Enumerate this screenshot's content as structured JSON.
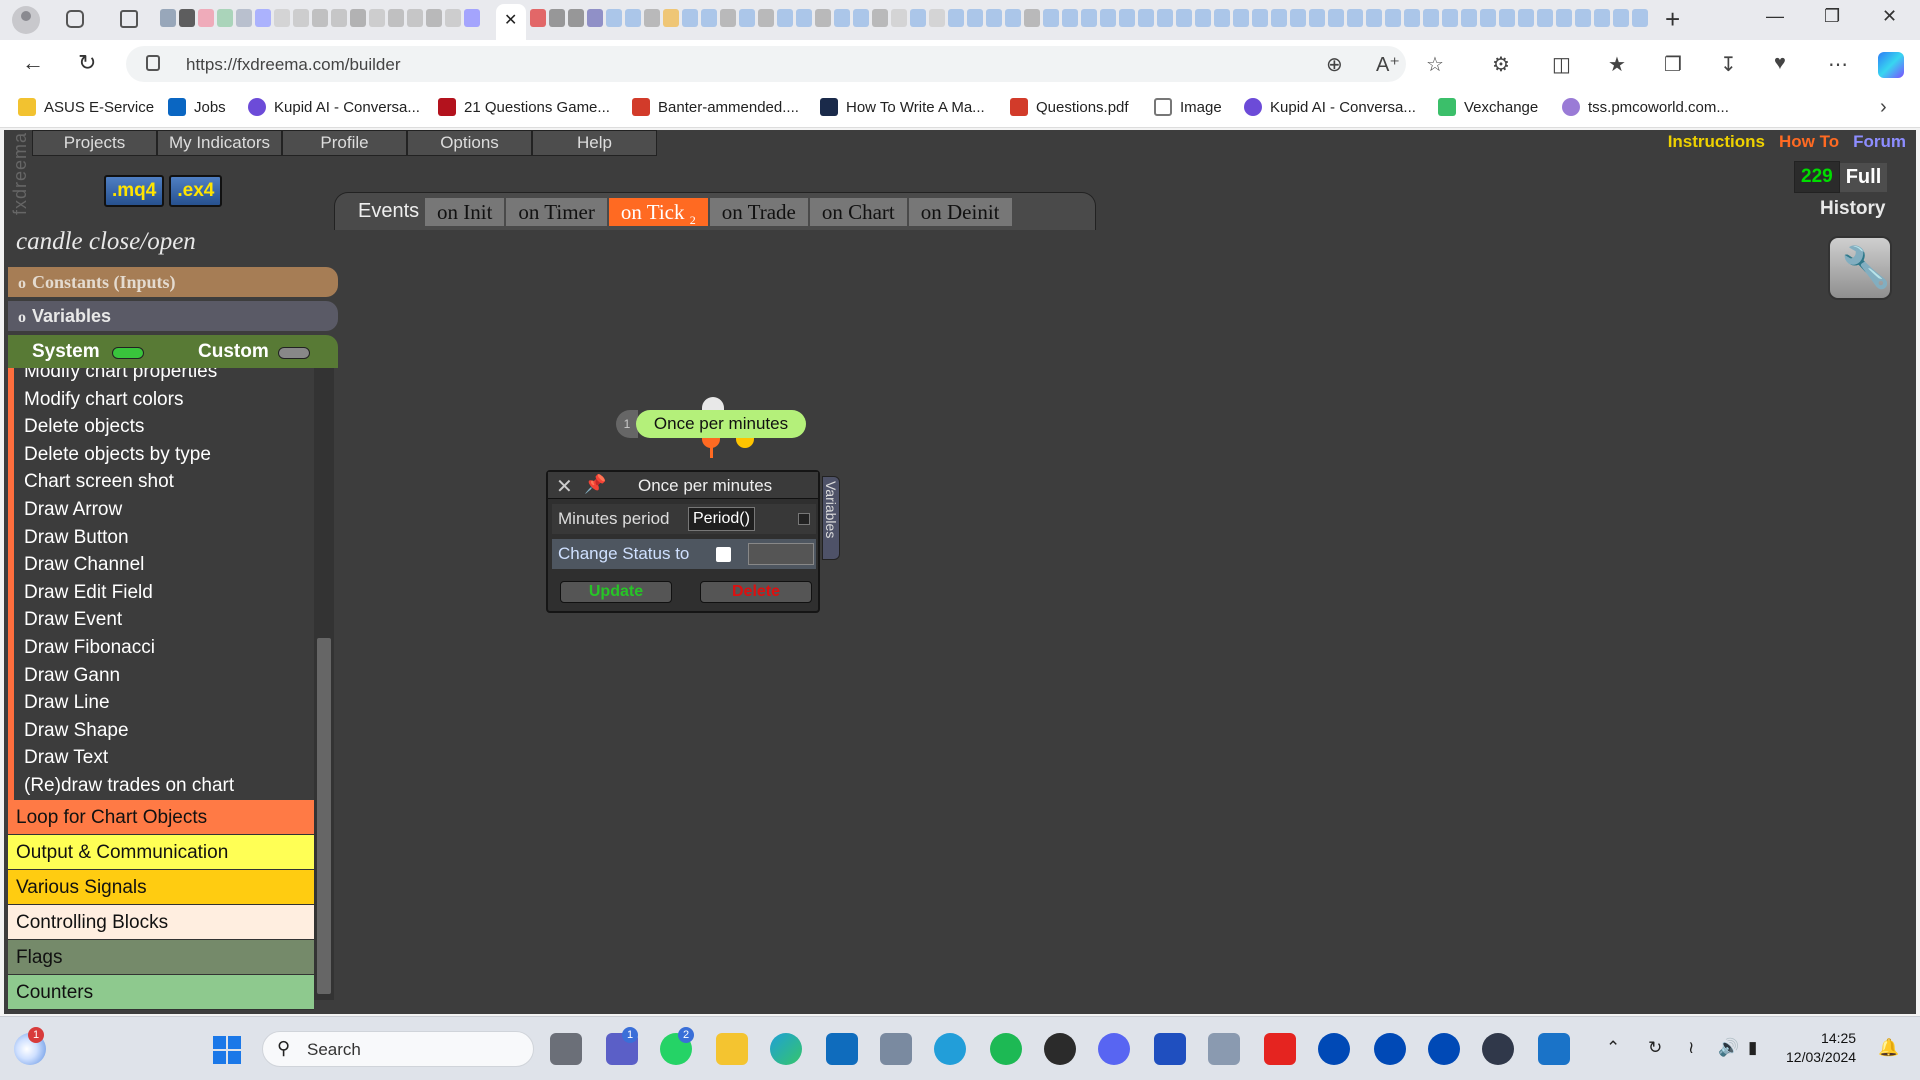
{
  "browser": {
    "url": "https://fxdreema.com/builder",
    "close_tab_glyph": "✕",
    "new_tab_glyph": "+",
    "bookmarks": [
      {
        "label": "ASUS E-Service",
        "icon": "folder-icon",
        "color": "#f2c230"
      },
      {
        "label": "Jobs",
        "icon": "linkedin-icon",
        "color": "#0a66c2"
      },
      {
        "label": "Kupid AI - Conversa...",
        "icon": "kupid-icon",
        "color": "#6c4bd8"
      },
      {
        "label": "21 Questions Game...",
        "icon": "tv-icon",
        "color": "#b3121d"
      },
      {
        "label": "Banter-ammended....",
        "icon": "pdf-icon",
        "color": "#d23b2a"
      },
      {
        "label": "How To Write A Ma...",
        "icon": "v-icon",
        "color": "#1a2a4a"
      },
      {
        "label": "Questions.pdf",
        "icon": "pdf-icon",
        "color": "#d23b2a"
      },
      {
        "label": "Image",
        "icon": "file-icon",
        "color": "#777777"
      },
      {
        "label": "Kupid AI - Conversa...",
        "icon": "kupid-icon",
        "color": "#6c4bd8"
      },
      {
        "label": "Vexchange",
        "icon": "vexchange-icon",
        "color": "#3bbf6a"
      },
      {
        "label": "tss.pmcoworld.com...",
        "icon": "globe-icon",
        "color": "#9a7bd6"
      }
    ]
  },
  "app": {
    "logo": "fxdreema",
    "menu": [
      "Projects",
      "My Indicators",
      "Profile",
      "Options",
      "Help"
    ],
    "ext_buttons": [
      ".mq4",
      ".ex4"
    ],
    "project_name": "candle close/open",
    "constants_label": "Constants (Inputs)",
    "variables_label": "Variables",
    "panel_bullet": "o",
    "system_label": "System",
    "custom_label": "Custom",
    "block_items": [
      "Modify chart properties",
      "Modify chart colors",
      "Delete objects",
      "Delete objects by type",
      "Chart screen shot",
      "Draw Arrow",
      "Draw Button",
      "Draw Channel",
      "Draw Edit Field",
      "Draw Event",
      "Draw Fibonacci",
      "Draw Gann",
      "Draw Line",
      "Draw Shape",
      "Draw Text",
      "(Re)draw trades on chart"
    ],
    "categories": {
      "loop": "Loop for Chart Objects",
      "output": "Output & Communication",
      "signals": "Various Signals",
      "control": "Controlling Blocks",
      "flags": "Flags",
      "counters": "Counters"
    },
    "events_label": "Events",
    "event_tabs": [
      "on Init",
      "on Timer",
      "on Tick",
      "on Trade",
      "on Chart",
      "on Deinit"
    ],
    "on_tick_sub": "2",
    "active_event": "on Tick",
    "links": {
      "instructions": "Instructions",
      "howto": "How To",
      "forum": "Forum"
    },
    "count": "229",
    "full": "Full",
    "history": "History",
    "block": {
      "number": "1",
      "label": "Once per minutes"
    },
    "dialog": {
      "title": "Once per minutes",
      "minutes_label": "Minutes period",
      "minutes_value": "Period()",
      "status_label": "Change Status to",
      "update": "Update",
      "delete": "Delete",
      "side_tab": "Variables"
    }
  },
  "taskbar": {
    "search_placeholder": "Search",
    "time": "14:25",
    "date": "12/03/2024",
    "badges": {
      "weather": "1",
      "teams": "1",
      "whatsapp": "2"
    }
  }
}
